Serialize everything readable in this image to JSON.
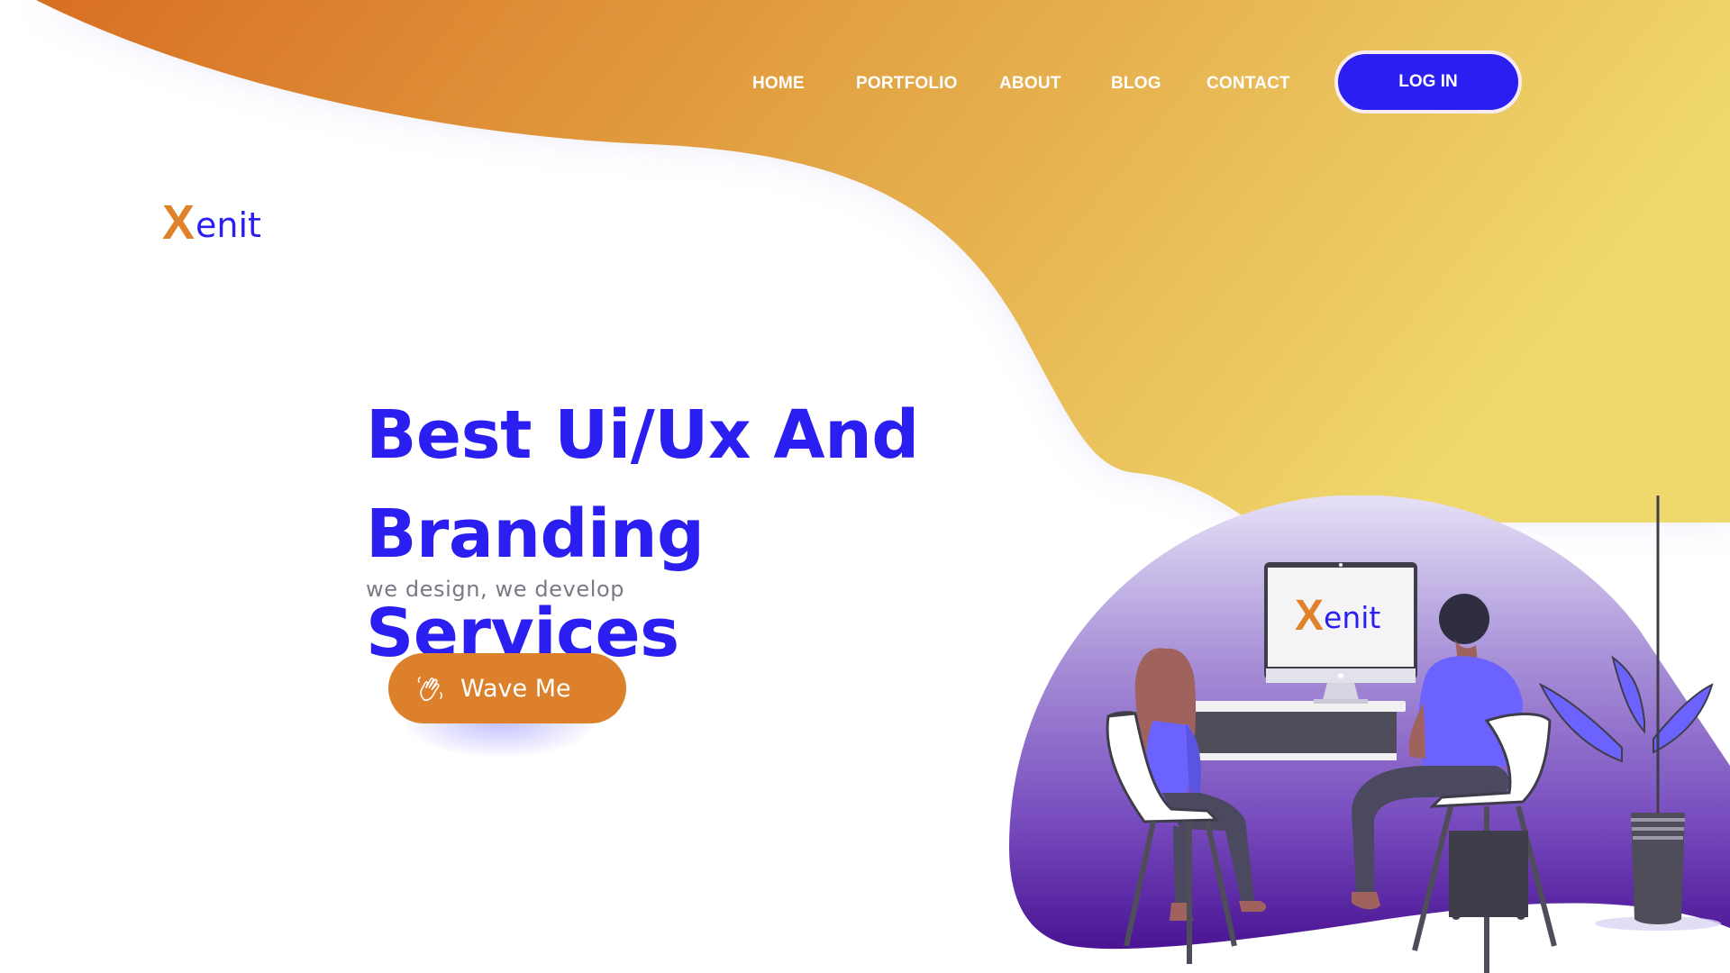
{
  "nav": {
    "items": [
      {
        "label": "HOME"
      },
      {
        "label": "PORTFOLIO"
      },
      {
        "label": "ABOUT"
      },
      {
        "label": "BLOG"
      },
      {
        "label": "CONTACT"
      }
    ],
    "login_label": "LOG IN"
  },
  "brand": {
    "logo_x": "X",
    "logo_rest": "enit"
  },
  "hero": {
    "title_line1": "Best Ui/Ux And",
    "title_line2": "Branding Services",
    "subtitle": "we design, we develop",
    "cta_label": "Wave Me",
    "cta_icon": "wave-hand-icon"
  },
  "illustration": {
    "screen_logo_x": "X",
    "screen_logo_rest": "enit"
  },
  "colors": {
    "primary": "#2a1ff0",
    "accent_orange": "#dd802b",
    "gradient_start": "#d9742a",
    "gradient_end": "#eed66a",
    "subtitle_gray": "#7a7a86",
    "blob_purple": "#5a1fa0"
  }
}
